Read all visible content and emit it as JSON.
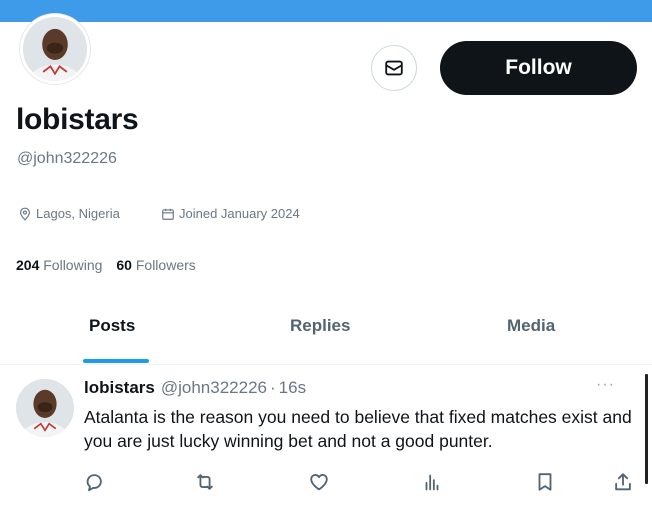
{
  "profile": {
    "display_name": "lobistars",
    "handle": "@john322226",
    "location": "Lagos, Nigeria",
    "joined": "Joined January 2024",
    "following_count": "204",
    "following_label": "Following",
    "followers_count": "60",
    "followers_label": "Followers"
  },
  "actions": {
    "follow_label": "Follow",
    "message_icon": "mail-icon"
  },
  "tabs": [
    {
      "label": "Posts",
      "active": true
    },
    {
      "label": "Replies",
      "active": false
    },
    {
      "label": "Media",
      "active": false
    }
  ],
  "post": {
    "author_name": "lobistars",
    "author_handle": "@john322226",
    "separator": "·",
    "time": "16s",
    "more": "···",
    "text": "Atalanta is the reason you need to believe that fixed matches exist and you are just lucky winning bet and not a good punter.",
    "action_icons": [
      "reply-icon",
      "repost-icon",
      "like-icon",
      "views-icon",
      "bookmark-icon",
      "share-icon"
    ]
  },
  "colors": {
    "banner": "#3d9be9",
    "accent": "#1d9bf0",
    "primary_text": "#0f1419",
    "secondary_text": "#6b7785",
    "follow_button_bg": "#0f1419"
  }
}
